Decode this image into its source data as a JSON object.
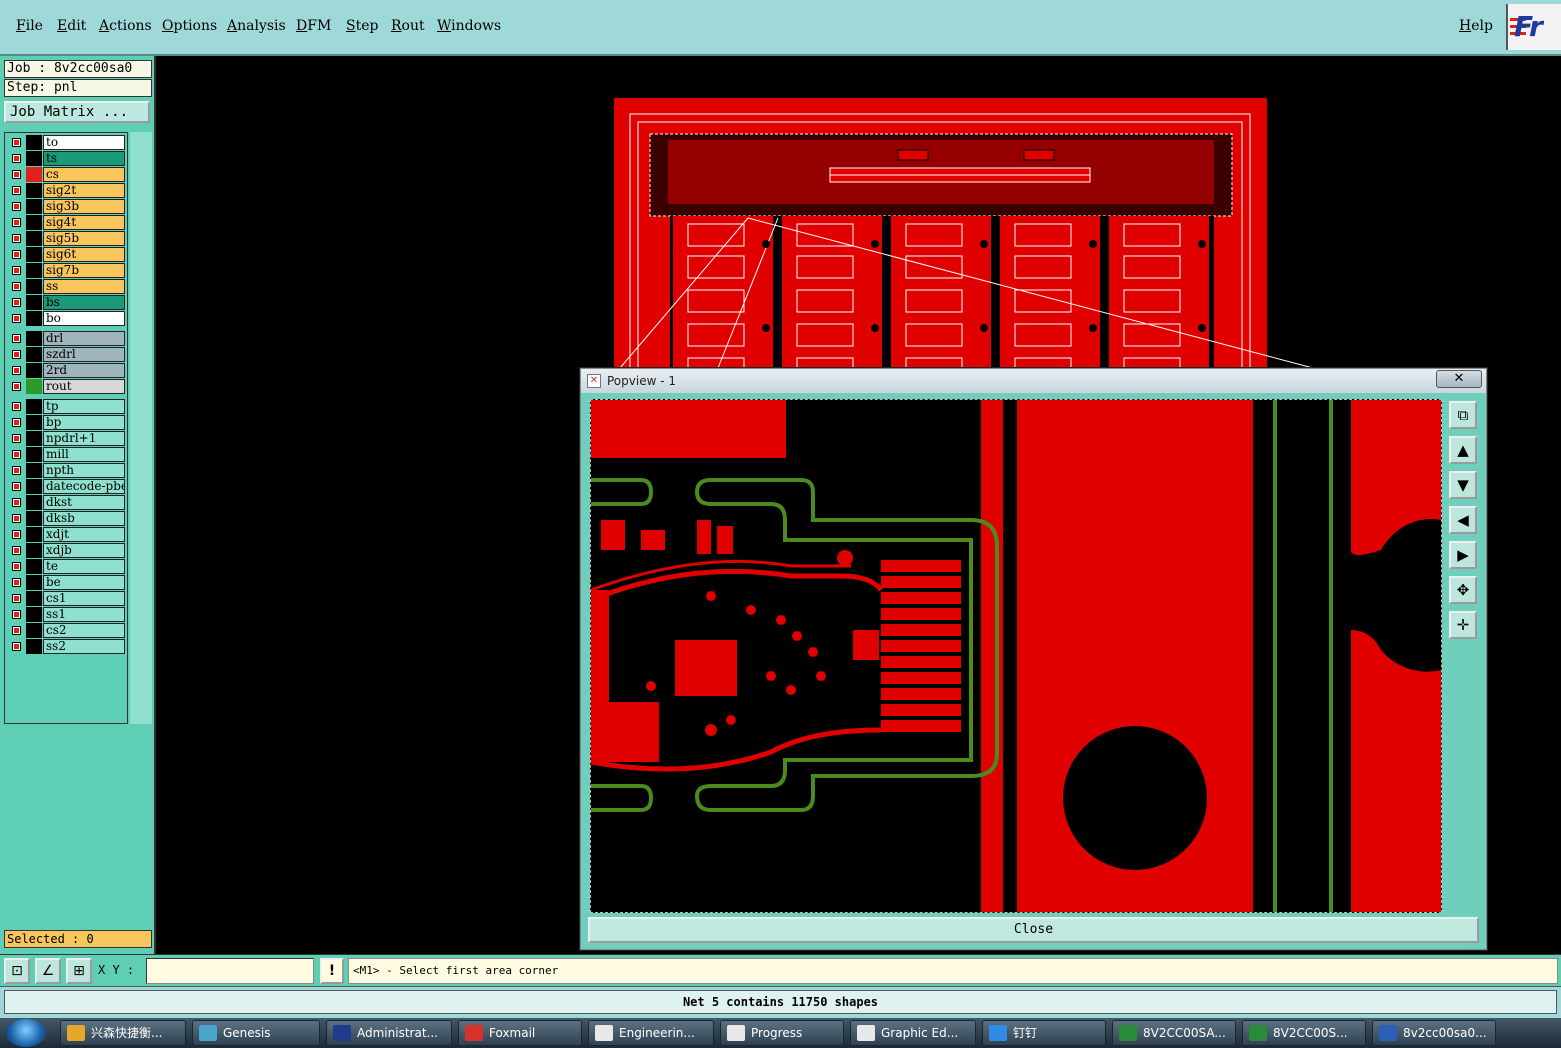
{
  "menu": {
    "items": [
      "File",
      "Edit",
      "Actions",
      "Options",
      "Analysis",
      "DFM",
      "Step",
      "Rout",
      "Windows"
    ],
    "help": "Help",
    "logo_text": "Fr"
  },
  "job": {
    "job_label": "Job : 8v2cc00sa0",
    "step_label": "Step: pnl",
    "matrix_button": "Job Matrix ..."
  },
  "layers": [
    {
      "name": "to",
      "bg": "#ffffff",
      "color": "#000000"
    },
    {
      "name": "ts",
      "bg": "#1a9a78",
      "color": "#000000"
    },
    {
      "name": "cs",
      "bg": "#f8c65c",
      "color": "#e0201c"
    },
    {
      "name": "sig2t",
      "bg": "#f8c65c",
      "color": "#000000"
    },
    {
      "name": "sig3b",
      "bg": "#f8c65c",
      "color": "#000000"
    },
    {
      "name": "sig4t",
      "bg": "#f8c65c",
      "color": "#000000"
    },
    {
      "name": "sig5b",
      "bg": "#f8c65c",
      "color": "#000000"
    },
    {
      "name": "sig6t",
      "bg": "#f8c65c",
      "color": "#000000"
    },
    {
      "name": "sig7b",
      "bg": "#f8c65c",
      "color": "#000000"
    },
    {
      "name": "ss",
      "bg": "#f8c65c",
      "color": "#000000"
    },
    {
      "name": "bs",
      "bg": "#1a9a78",
      "color": "#000000"
    },
    {
      "name": "bo",
      "bg": "#ffffff",
      "color": "#000000"
    },
    {
      "name": "drl",
      "bg": "#9fb4bc",
      "color": "#000000"
    },
    {
      "name": "szdrl",
      "bg": "#9fb4bc",
      "color": "#000000"
    },
    {
      "name": "2rd",
      "bg": "#9fb4bc",
      "color": "#000000"
    },
    {
      "name": "rout",
      "bg": "#d8d8d8",
      "color": "#2a9a2a"
    },
    {
      "name": "tp",
      "bg": "#8fe0cf",
      "color": "#000000"
    },
    {
      "name": "bp",
      "bg": "#8fe0cf",
      "color": "#000000"
    },
    {
      "name": "npdrl+1",
      "bg": "#8fe0cf",
      "color": "#000000"
    },
    {
      "name": "mill",
      "bg": "#8fe0cf",
      "color": "#000000"
    },
    {
      "name": "npth",
      "bg": "#8fe0cf",
      "color": "#000000"
    },
    {
      "name": "datecode-pbe",
      "bg": "#8fe0cf",
      "color": "#000000"
    },
    {
      "name": "dkst",
      "bg": "#8fe0cf",
      "color": "#000000"
    },
    {
      "name": "dksb",
      "bg": "#8fe0cf",
      "color": "#000000"
    },
    {
      "name": "xdjt",
      "bg": "#8fe0cf",
      "color": "#000000"
    },
    {
      "name": "xdjb",
      "bg": "#8fe0cf",
      "color": "#000000"
    },
    {
      "name": "te",
      "bg": "#8fe0cf",
      "color": "#000000"
    },
    {
      "name": "be",
      "bg": "#8fe0cf",
      "color": "#000000"
    },
    {
      "name": "cs1",
      "bg": "#8fe0cf",
      "color": "#000000"
    },
    {
      "name": "ss1",
      "bg": "#8fe0cf",
      "color": "#000000"
    },
    {
      "name": "cs2",
      "bg": "#8fe0cf",
      "color": "#000000"
    },
    {
      "name": "ss2",
      "bg": "#8fe0cf",
      "color": "#000000"
    }
  ],
  "selected_label": "Selected : 0",
  "popview": {
    "title": "Popview - 1",
    "close_x": "✕",
    "close_button": "Close"
  },
  "command": {
    "xy_label": "X Y :",
    "xy_value": "",
    "alert": "!",
    "prompt": "<M1> - Select first area corner"
  },
  "status": "Net 5 contains 11750 shapes",
  "taskbar": [
    {
      "label": "兴森快捷衡...",
      "icon_color": "#e6a62c"
    },
    {
      "label": "Genesis",
      "icon_color": "#4aa3c8"
    },
    {
      "label": "Administrat...",
      "icon_color": "#1f3c8a"
    },
    {
      "label": "Foxmail",
      "icon_color": "#d8302a"
    },
    {
      "label": "Engineerin...",
      "icon_color": "#e8e8e8"
    },
    {
      "label": "Progress",
      "icon_color": "#e8e8e8"
    },
    {
      "label": "Graphic Ed...",
      "icon_color": "#e8e8e8"
    },
    {
      "label": "钉钉",
      "icon_color": "#2f8ae8"
    },
    {
      "label": "8V2CC00SA...",
      "icon_color": "#2a8a3c"
    },
    {
      "label": "8V2CC00S...",
      "icon_color": "#2a8a3c"
    },
    {
      "label": "8v2cc00sa0...",
      "icon_color": "#2b5fb8"
    }
  ],
  "colors": {
    "copper": "#e00000",
    "rout": "#4a8a1e",
    "panel_bg": "#5ecfb4",
    "menubar_bg": "#9fd8d8"
  }
}
